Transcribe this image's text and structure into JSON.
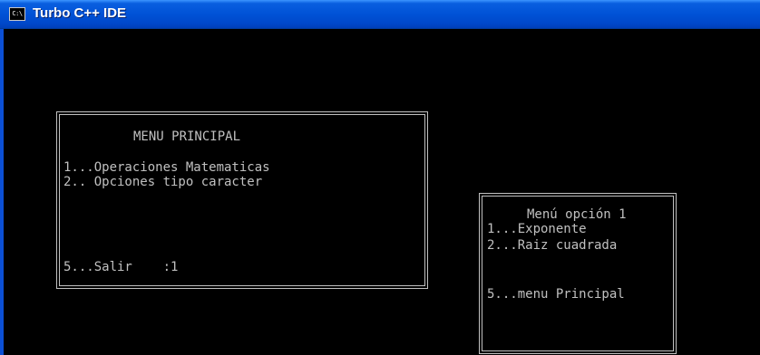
{
  "window": {
    "icon_text": "C:\\",
    "title": "Turbo C++ IDE"
  },
  "main_menu": {
    "title": "MENU PRINCIPAL",
    "items": [
      "1...Operaciones Matematicas",
      "2.. Opciones tipo caracter"
    ],
    "exit_line": "5...Salir    :1"
  },
  "sub_menu": {
    "title": "Menú opción 1",
    "items": [
      "1...Exponente",
      "2...Raiz cuadrada"
    ],
    "back_line": "5...menu Principal"
  },
  "colors": {
    "titlebar": "#0052d6",
    "console_bg": "#000000",
    "console_text": "#c0c0c0"
  }
}
